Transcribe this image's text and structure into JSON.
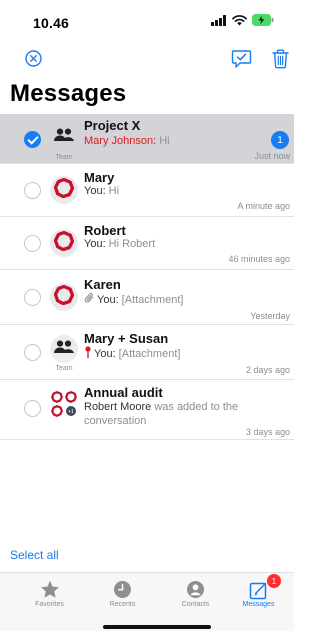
{
  "status_bar": {
    "time": "10.46",
    "icons": [
      "cellular-signal-icon",
      "wifi-icon",
      "battery-charging-icon"
    ]
  },
  "toolbar": {
    "left_icon": "close-circle-icon",
    "right_icons": [
      "mark-read-icon",
      "trash-icon"
    ]
  },
  "page": {
    "title": "Messages"
  },
  "conversations": [
    {
      "name": "Project X",
      "sender": "Mary Johnson:",
      "text": " Hi",
      "time": "Just now",
      "avatar": "group-icon",
      "caption": "Team",
      "selected": true,
      "unread": "1"
    },
    {
      "name": "Mary",
      "sender": "You:",
      "text": " Hi",
      "time": "A minute ago",
      "avatar": "red-badge-icon"
    },
    {
      "name": "Robert",
      "sender": "You:",
      "text": " Hi Robert",
      "time": "46 minutes ago",
      "avatar": "red-badge-icon"
    },
    {
      "name": "Karen",
      "sender": "You:",
      "text": " [Attachment]",
      "time": "Yesterday",
      "avatar": "red-badge-icon",
      "marker": "paperclip-icon"
    },
    {
      "name": "Mary + Susan",
      "sender": "You:",
      "text": " [Attachment]",
      "time": "2 days ago",
      "avatar": "group-icon",
      "caption": "Team",
      "marker": "pin-icon"
    },
    {
      "name": "Annual audit",
      "sender": "Robert Moore",
      "text": " was added to the",
      "text2": "conversation",
      "time": "3 days ago",
      "avatar": "multi-badge-icon",
      "avatar_count": "+1"
    }
  ],
  "footer": {
    "select_all": "Select all"
  },
  "tabs": [
    {
      "label": "Favorites",
      "icon": "star-icon"
    },
    {
      "label": "Recents",
      "icon": "clock-icon"
    },
    {
      "label": "Contacts",
      "icon": "person-icon"
    },
    {
      "label": "Messages",
      "icon": "messages-icon",
      "active": true,
      "badge": "1"
    }
  ],
  "colors": {
    "accent": "#1a7cf2",
    "selected_row": "#d3d3d8",
    "brand_red": "#c8102e",
    "alert_red": "#e2171b"
  }
}
